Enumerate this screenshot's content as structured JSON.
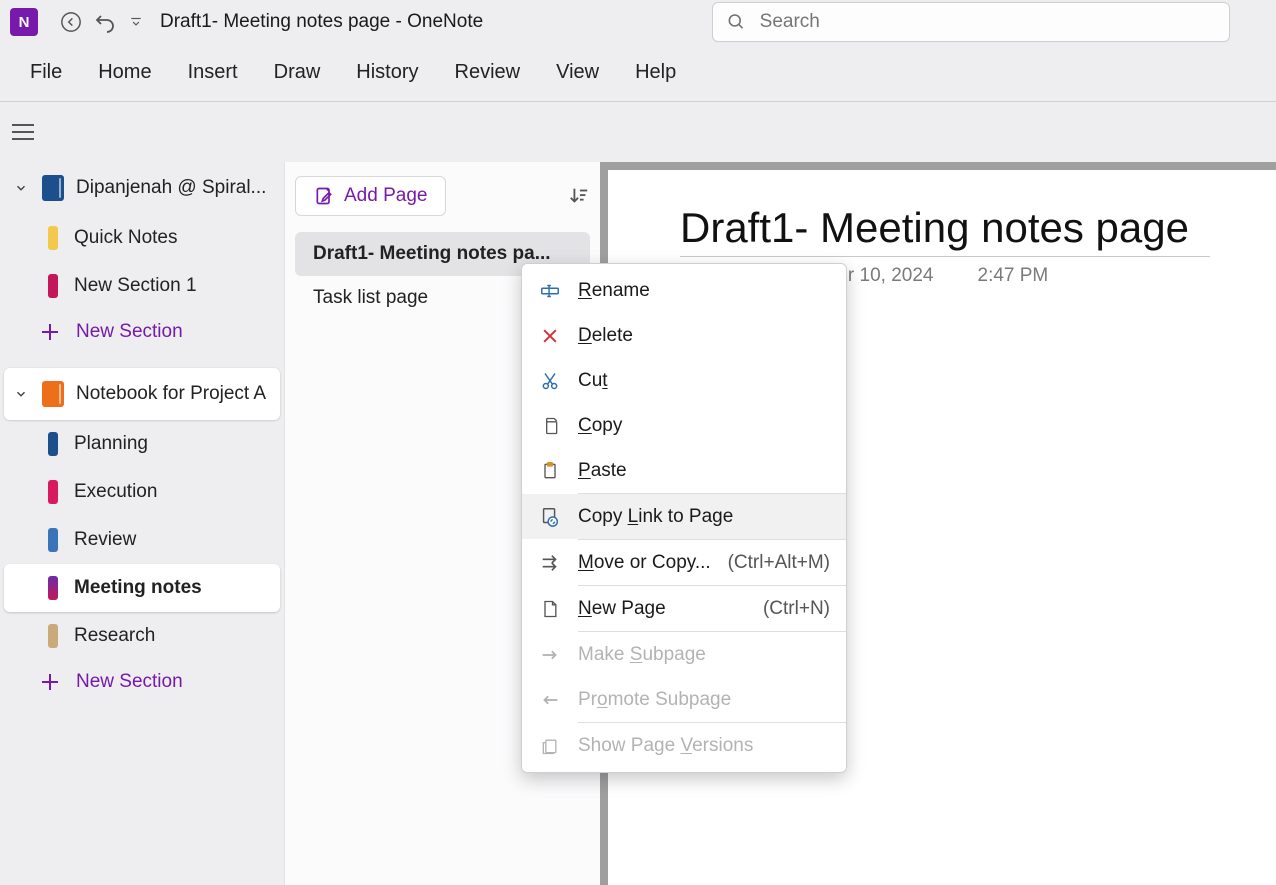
{
  "titlebar": {
    "doc_title": "Draft1- Meeting notes page  -  OneNote",
    "search_placeholder": "Search"
  },
  "ribbon": {
    "tabs": [
      "File",
      "Home",
      "Insert",
      "Draw",
      "History",
      "Review",
      "View",
      "Help"
    ]
  },
  "sidebar": {
    "notebooks": [
      {
        "name": "Dipanjenah @ Spiral...",
        "color": "blue",
        "sections": [
          {
            "label": "Quick Notes",
            "color": "#f2c94c"
          },
          {
            "label": "New Section 1",
            "color": "#c2185b"
          }
        ]
      },
      {
        "name": "Notebook for Project A",
        "color": "orange",
        "hover": true,
        "sections": [
          {
            "label": "Planning",
            "color": "#1d4f8c"
          },
          {
            "label": "Execution",
            "color": "#d81b60"
          },
          {
            "label": "Review",
            "color": "#3b74b8"
          },
          {
            "label": "Meeting notes",
            "color": "#6a2da8",
            "selected": true
          },
          {
            "label": "Research",
            "color": "#caa97a"
          }
        ]
      }
    ],
    "new_section_label": "New Section"
  },
  "pageList": {
    "add_page_label": "Add Page",
    "pages": [
      {
        "label": "Draft1- Meeting notes pa...",
        "active": true
      },
      {
        "label": "Task list page",
        "active": false
      }
    ]
  },
  "canvas": {
    "title": "Draft1- Meeting notes page",
    "date": "Tuesday, September 10, 2024",
    "time": "2:47 PM"
  },
  "contextMenu": {
    "items": [
      {
        "id": "rename",
        "label": "Rename",
        "mnemonic": "R",
        "icon": "rename-icon"
      },
      {
        "id": "delete",
        "label": "Delete",
        "mnemonic": "D",
        "icon": "delete-icon"
      },
      {
        "id": "cut",
        "label": "Cut",
        "mnemonic": "t",
        "icon": "cut-icon"
      },
      {
        "id": "copy",
        "label": "Copy",
        "mnemonic": "C",
        "icon": "copy-icon"
      },
      {
        "id": "paste",
        "label": "Paste",
        "mnemonic": "P",
        "icon": "paste-icon"
      },
      {
        "sep": true
      },
      {
        "id": "copy-link",
        "label": "Copy Link to Page",
        "mnemonic": "L",
        "icon": "link-icon",
        "hover": true
      },
      {
        "sep": true
      },
      {
        "id": "move-copy",
        "label": "Move or Copy...",
        "mnemonic": "M",
        "shortcut": "(Ctrl+Alt+M)",
        "icon": "move-icon"
      },
      {
        "sep": true
      },
      {
        "id": "new-page",
        "label": "New Page",
        "mnemonic": "N",
        "shortcut": "(Ctrl+N)",
        "icon": "newpage-icon"
      },
      {
        "sep": true
      },
      {
        "id": "make-subpage",
        "label": "Make Subpage",
        "mnemonic": "S",
        "icon": "indent-icon",
        "disabled": true
      },
      {
        "id": "promote-subpage",
        "label": "Promote Subpage",
        "mnemonic": "o",
        "icon": "outdent-icon",
        "disabled": true
      },
      {
        "sep": true
      },
      {
        "id": "show-versions",
        "label": "Show Page Versions",
        "mnemonic": "V",
        "icon": "versions-icon",
        "disabled": true
      }
    ]
  }
}
